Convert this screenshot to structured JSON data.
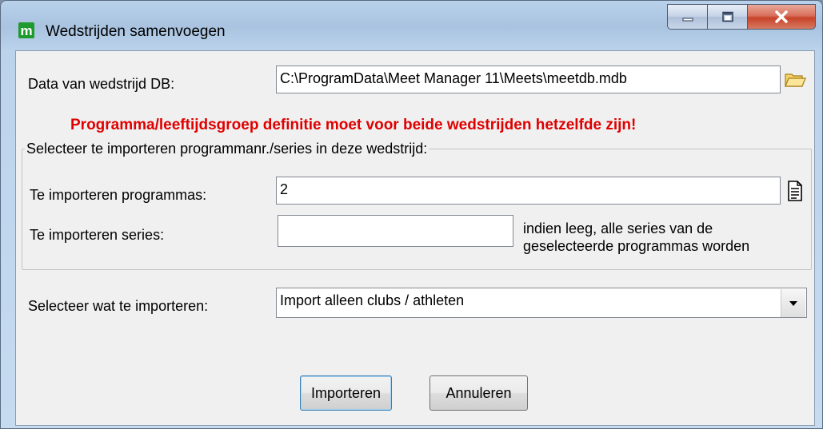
{
  "window": {
    "title": "Wedstrijden samenvoegen",
    "app_icon_letter": "m",
    "controls": {
      "minimize": "minimize-icon",
      "maximize": "maximize-icon",
      "close": "close-icon"
    }
  },
  "db": {
    "label": "Data van wedstrijd DB:",
    "path": "C:\\ProgramData\\Meet Manager 11\\Meets\\meetdb.mdb",
    "browse_icon": "folder-open-icon"
  },
  "warning": "Programma/leeftijdsgroep definitie moet voor beide wedstrijden hetzelfde zijn!",
  "group": {
    "legend": "Selecteer te importeren programmanr./series in deze wedstrijd:",
    "programs_label": "Te importeren programmas:",
    "programs_value": "2",
    "programs_button_icon": "document-list-icon",
    "series_label": "Te importeren series:",
    "series_value": "",
    "series_hint_line1": "indien leeg, alle series van de",
    "series_hint_line2": "geselecteerde programmas worden"
  },
  "import_select": {
    "label": "Selecteer wat te importeren:",
    "value": "Import alleen clubs / athleten"
  },
  "buttons": {
    "import": "Importeren",
    "cancel": "Annuleren"
  },
  "colors": {
    "warning": "#e00000",
    "app_icon": "#1e9a2e",
    "close_button": "#c8432a"
  }
}
